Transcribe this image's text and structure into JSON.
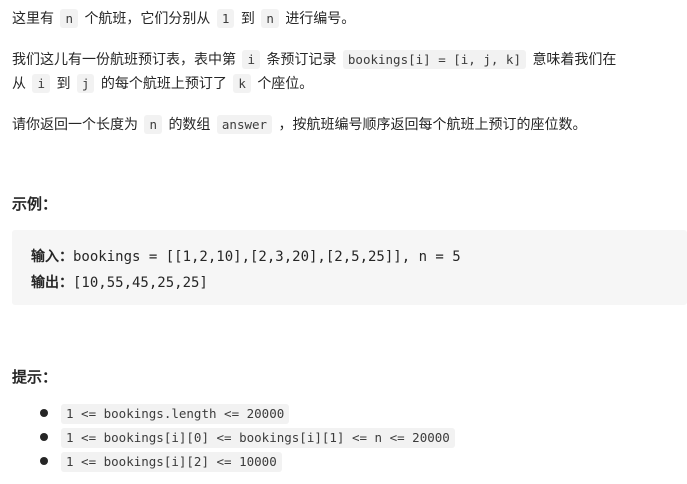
{
  "intro": {
    "p1": {
      "t1": "这里有",
      "c1": "n",
      "t2": "个航班，它们分别从",
      "c2": "1",
      "t3": "到",
      "c3": "n",
      "t4": "进行编号。"
    },
    "p2": {
      "t1": "我们这儿有一份航班预订表，表中第",
      "c1": "i",
      "t2": "条预订记录",
      "c2": "bookings[i] = [i, j, k]",
      "t3": "意味着我们在"
    },
    "p3": {
      "t1": "从",
      "c1": "i",
      "t2": "到",
      "c2": "j",
      "t3": "的每个航班上预订了",
      "c3": "k",
      "t4": "个座位。"
    },
    "p4": {
      "t1": "请你返回一个长度为",
      "c1": "n",
      "t2": "的数组",
      "c2": "answer",
      "t3": "，按航班编号顺序返回每个航班上预订的座位数。"
    }
  },
  "example": {
    "heading": "示例：",
    "input_label": "输入：",
    "input_value": "bookings = [[1,2,10],[2,3,20],[2,5,25]], n = 5",
    "output_label": "输出：",
    "output_value": "[10,55,45,25,25]"
  },
  "hints": {
    "heading": "提示：",
    "items": [
      "1 <= bookings.length <= 20000",
      "1 <= bookings[i][0] <= bookings[i][1] <= n <= 20000",
      "1 <= bookings[i][2] <= 10000"
    ]
  }
}
